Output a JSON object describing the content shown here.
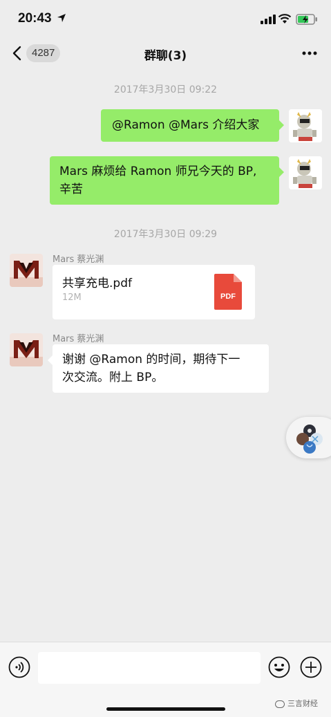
{
  "status_bar": {
    "time": "20:43"
  },
  "nav": {
    "unread_count": "4287",
    "title": "群聊(3)"
  },
  "messages": {
    "ts1": "2017年3月30日 09:22",
    "m1": "@Ramon @Mars 介绍大家",
    "m2_line1": "Mars 麻烦给 Ramon 师兄今天的 BP,",
    "m2_line2": "辛苦",
    "ts2": "2017年3月30日 09:29",
    "sender1": "Mars 蔡光渊",
    "file_name": "共享充电.pdf",
    "file_size": "12M",
    "file_icon_label": "PDF",
    "sender2": "Mars 蔡光渊",
    "m3_line1": "谢谢 @Ramon 的时间，期待下一",
    "m3_line2": "次交流。附上 BP。"
  },
  "input_bar": {
    "value": "",
    "watermark": "三言财经"
  },
  "icons": {
    "back": "chevron-left-icon",
    "more": "more-dots-icon",
    "voice": "voice-icon",
    "emoji": "emoji-icon",
    "plus": "plus-icon",
    "pdf": "pdf-file-icon"
  },
  "colors": {
    "bubble_green": "#95ec69",
    "background": "#ededed",
    "pdf_red": "#e84a3b"
  }
}
